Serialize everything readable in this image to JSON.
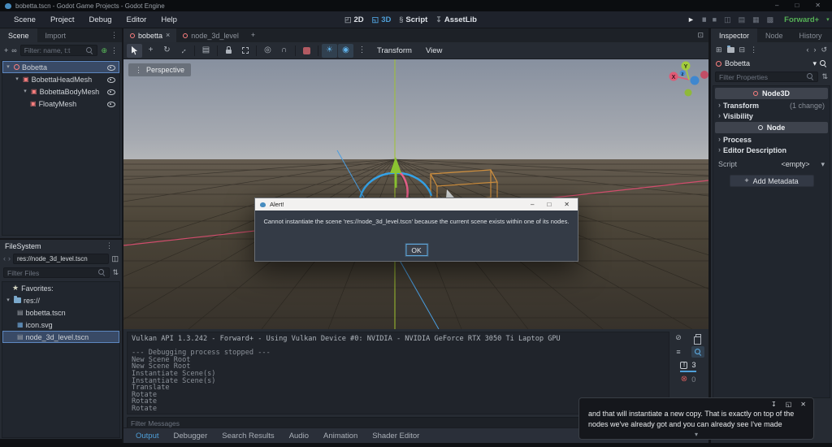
{
  "colors": {
    "accent_blue": "#4f9fd8",
    "node3d_red": "#fc7f7f",
    "renderer_green": "#55b055",
    "axis_red": "#d14d6d",
    "axis_green": "#9fc32f",
    "axis_blue": "#4a9de0",
    "selection_orange": "#cf8f3e"
  },
  "icons": {
    "dots": "⋮",
    "plus": "+",
    "close": "×",
    "back": "‹",
    "forward": "›",
    "chevron_down": "▾",
    "caret": "›",
    "star": "★",
    "expand": "⊡",
    "minimize": "–",
    "maximize": "□",
    "win_close": "✕",
    "play": "►",
    "pause": "▮▮",
    "stop": "■",
    "remote": "◫",
    "clapper": "▤",
    "clapper2": "▦",
    "movie": "▩",
    "link": "∞",
    "script_add": "⊕",
    "list_select": "▤",
    "local_space": "◎",
    "snap": "∩",
    "sun": "☀",
    "environment": "◉",
    "undo": "↺",
    "new_resource": "⊞",
    "save": "⊟",
    "sort": "⇅",
    "split": "◫",
    "sliders": "⇅",
    "filter_list": "≡",
    "clear": "⊘",
    "warning": "!",
    "error": "⊗",
    "pin": "↧",
    "popout": "◱",
    "ws2d": "◰",
    "ws3d": "◱",
    "script_ws": "§",
    "assetlib": "↧",
    "move": "+",
    "rotate": "↻",
    "scale": "↔",
    "image": "▦",
    "mesh": "▣"
  },
  "titlebar": {
    "title": "bobetta.tscn - Godot Game Projects - Godot Engine"
  },
  "menubar": {
    "menus": [
      "Scene",
      "Project",
      "Debug",
      "Editor",
      "Help"
    ],
    "workspaces": [
      "2D",
      "3D",
      "Script",
      "AssetLib"
    ],
    "active_workspace": "3D",
    "renderer": "Forward+"
  },
  "scene_dock": {
    "tabs": [
      "Scene",
      "Import"
    ],
    "active_tab": "Scene",
    "filter_placeholder": "Filter: name, t:t",
    "nodes": [
      {
        "name": "Bobetta",
        "type": "Node3D",
        "selected": true
      },
      {
        "name": "BobettaHeadMesh",
        "type": "MeshInstance3D"
      },
      {
        "name": "BobettaBodyMesh",
        "type": "MeshInstance3D"
      },
      {
        "name": "FloatyMesh",
        "type": "MeshInstance3D"
      }
    ]
  },
  "filesystem_dock": {
    "title": "FileSystem",
    "path": "res://node_3d_level.tscn",
    "filter_placeholder": "Filter Files",
    "items": [
      "Favorites:",
      "res://",
      "bobetta.tscn",
      "icon.svg",
      "node_3d_level.tscn"
    ],
    "selected_item": "node_3d_level.tscn"
  },
  "scene_tabs": {
    "tabs": [
      "bobetta",
      "node_3d_level"
    ],
    "active": "bobetta"
  },
  "viewport": {
    "perspective_label": "Perspective",
    "transform_menu": "Transform",
    "view_menu": "View",
    "gizmo": {
      "x": "X",
      "y": "Y",
      "z": "z"
    }
  },
  "alert": {
    "title": "Alert!",
    "message": "Cannot instantiate the scene 'res://node_3d_level.tscn' because the current scene exists within one of its nodes.",
    "ok": "OK"
  },
  "output": {
    "log_lines": [
      "Vulkan API 1.3.242 - Forward+ - Using Vulkan Device #0: NVIDIA - NVIDIA GeForce RTX 3050 Ti Laptop GPU",
      "",
      "--- Debugging process stopped ---",
      "New Scene Root",
      "New Scene Root",
      "Instantiate Scene(s)",
      "Instantiate Scene(s)",
      "Translate",
      "Rotate",
      "Rotate",
      "Rotate"
    ],
    "filter_placeholder": "Filter Messages",
    "warning_count": "3",
    "error_count": "0",
    "tabs": [
      "Output",
      "Debugger",
      "Search Results",
      "Audio",
      "Animation",
      "Shader Editor"
    ],
    "active_tab": "Output"
  },
  "inspector": {
    "tabs": [
      "Inspector",
      "Node",
      "History"
    ],
    "active_tab": "Inspector",
    "selected_node": "Bobetta",
    "filter_placeholder": "Filter Properties",
    "sections": [
      {
        "label": "Node3D"
      },
      {
        "label": "Node"
      }
    ],
    "rows": [
      {
        "label": "Transform",
        "badge": "(1 change)"
      },
      {
        "label": "Visibility",
        "badge": ""
      },
      {
        "label": "Process",
        "badge": ""
      },
      {
        "label": "Editor Description",
        "badge": ""
      }
    ],
    "script_label": "Script",
    "script_value": "<empty>",
    "add_metadata": "Add Metadata"
  },
  "toast": {
    "line1": "and that will instantiate a new copy. That is exactly on top of the",
    "line2": "nodes we've already got and you can already see I've made"
  }
}
